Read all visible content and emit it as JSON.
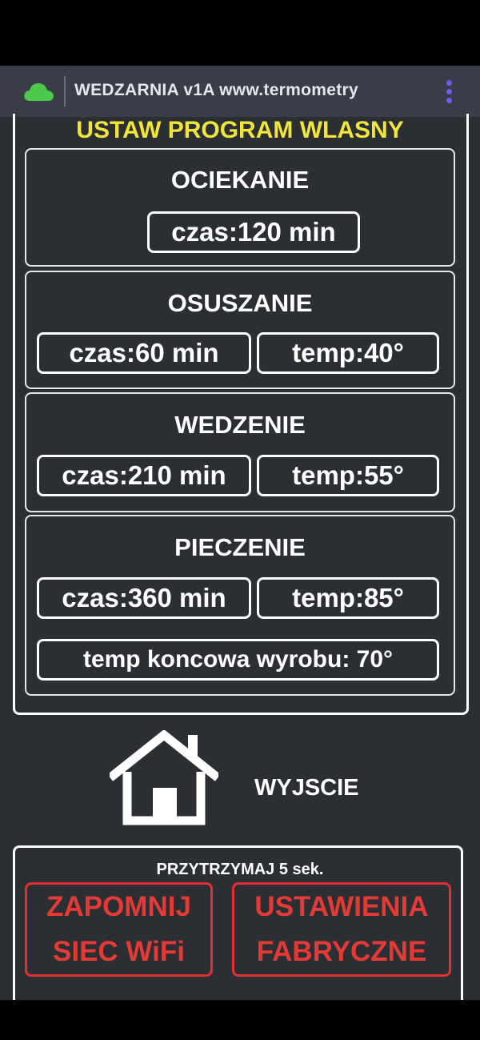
{
  "browser": {
    "title": "WEDZARNIA v1A www.termometry",
    "colors": {
      "bar": "#3a3c48",
      "cloud": "#4cc94c",
      "menu_dots": "#6a5cf0"
    },
    "icons": [
      "cloud-icon",
      "more-vert-icon"
    ]
  },
  "program": {
    "title": "USTAW PROGRAM WLASNY",
    "title_color": "#f1e53c",
    "sections": {
      "ociekanie": {
        "title": "OCIEKANIE",
        "czas": "czas:120 min"
      },
      "osuszanie": {
        "title": "OSUSZANIE",
        "czas": "czas:60 min",
        "temp": "temp:40°"
      },
      "wedzenie": {
        "title": "WEDZENIE",
        "czas": "czas:210 min",
        "temp": "temp:55°"
      },
      "pieczenie": {
        "title": "PIECZENIE",
        "czas": "czas:360 min",
        "temp": "temp:85°",
        "end_temp": "temp koncowa wyrobu: 70°"
      }
    }
  },
  "exit": {
    "label": "WYJSCIE",
    "icon": "home-icon"
  },
  "reset": {
    "note": "PRZYTRZYMAJ 5 sek.",
    "forget_wifi_line1": "ZAPOMNIJ",
    "forget_wifi_line2": "SIEC WiFi",
    "factory_line1": "USTAWIENIA",
    "factory_line2": "FABRYCZNE",
    "color": "#e0302f"
  }
}
